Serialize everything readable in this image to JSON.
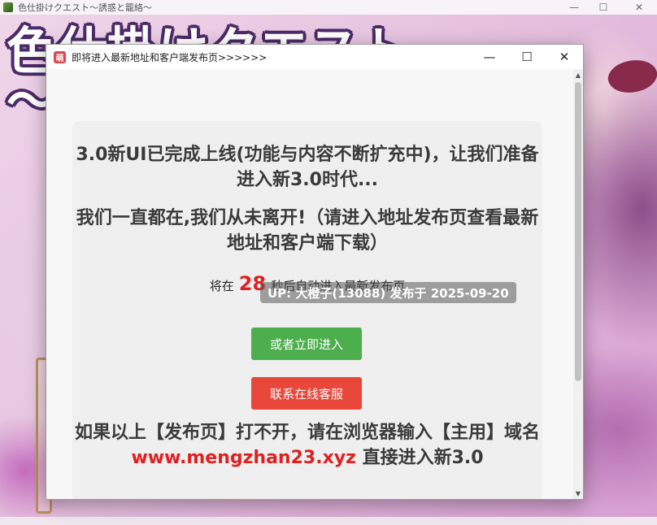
{
  "background_window": {
    "title": "色仕掛けクエスト～誘惑と籠絡～",
    "logo_text": "色仕掛けクエスト",
    "logo_sub": "～",
    "controls": {
      "minimize": "—",
      "maximize": "☐",
      "close": "✕"
    }
  },
  "dialog": {
    "icon_label": "萌",
    "title": "即将进入最新地址和客户端发布页>>>>>>",
    "controls": {
      "minimize": "—",
      "maximize": "☐",
      "close": "✕"
    },
    "headline_1": "3.0新UI已完成上线(功能与内容不断扩充中)，让我们准备进入新3.0时代...",
    "headline_2": "我们一直都在,我们从未离开!（请进入地址发布页查看最新地址和客户端下载）",
    "countdown_prefix": "将在",
    "countdown_seconds": "28",
    "countdown_suffix": "秒后自动进入最新发布页",
    "enter_button": "或者立即进入",
    "service_button": "联系在线客服",
    "footer_prefix": "如果以上【发布页】打不开，请在浏览器输入【主用】域名",
    "footer_domain": "www.mengzhan23.xyz",
    "footer_suffix": "直接进入新3.0",
    "toast": "UP: 大橙子(13088) 发布于 2025-09-20",
    "scroll": {
      "up": "▲",
      "down": "▼"
    }
  },
  "colors": {
    "accent_red": "#e02020",
    "enter_button": "#4cae4c",
    "service_button": "#e8473a"
  }
}
